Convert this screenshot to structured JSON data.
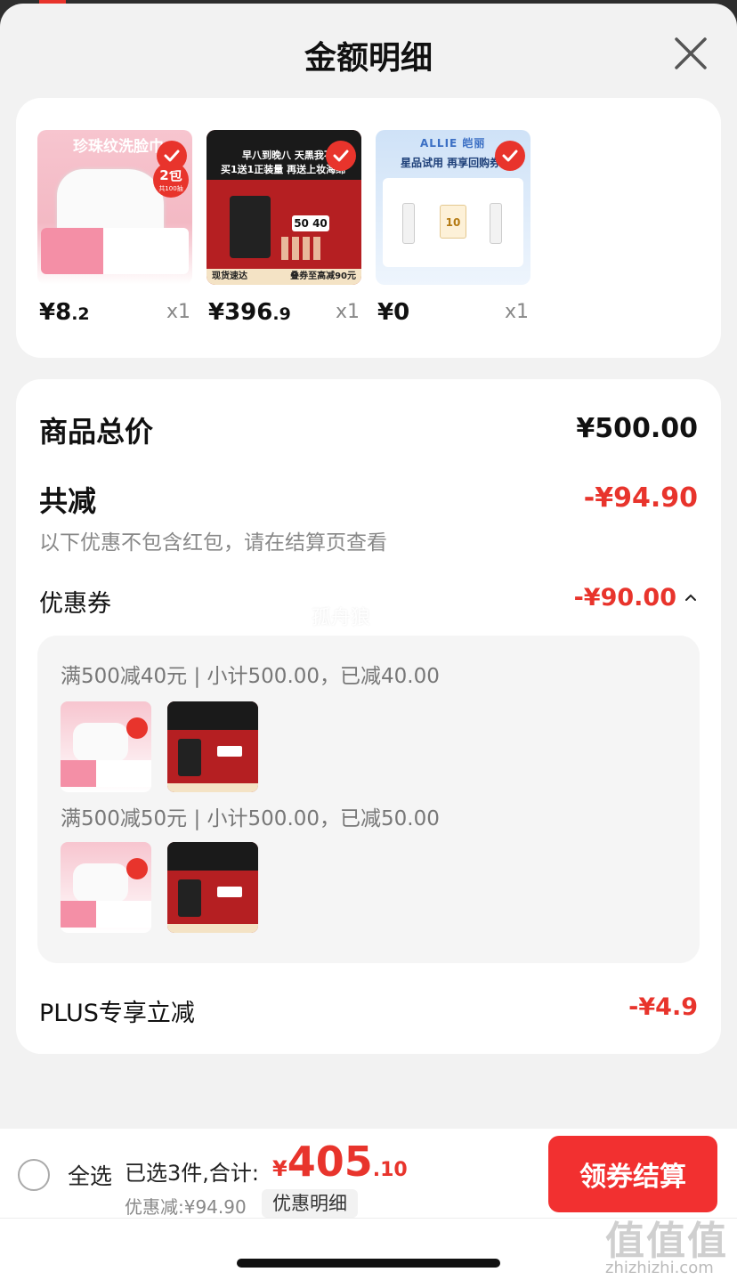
{
  "header": {
    "title": "金额明细"
  },
  "products": [
    {
      "currency": "¥",
      "price_int": "8",
      "price_dec": ".2",
      "qty": "x1",
      "img_text": "珍珠纹洗脸巾",
      "badge": "2包",
      "badge_sub": "共100抽"
    },
    {
      "currency": "¥",
      "price_int": "396",
      "price_dec": ".9",
      "qty": "x1",
      "img_text": "早八到晚八 天黑我不慌",
      "img_text2": "买1送1正装量 再送上妆海绵",
      "img_footer_left": "现货速达",
      "img_footer_right": "叠券至高减90元"
    },
    {
      "currency": "¥",
      "price_int": "0",
      "price_dec": "",
      "qty": "x1",
      "img_brand": "ALLIE 皑丽",
      "img_text": "星品试用 再享回购券"
    }
  ],
  "summary": {
    "goods_total_label": "商品总价",
    "goods_total_value": "¥500.00",
    "discount_label": "共减",
    "discount_value": "-¥94.90",
    "discount_note": "以下优惠不包含红包，请在结算页查看",
    "coupon_label": "优惠券",
    "coupon_value": "-¥90.00",
    "coupon_rules": [
      "满500减40元 | 小计500.00，已减40.00",
      "满500减50元 | 小计500.00，已减50.00"
    ],
    "plus_label": "PLUS专享立减",
    "plus_value": "-¥4.9"
  },
  "watermark": "孤舟狼",
  "bottom": {
    "select_all": "全选",
    "selected": "已选3件,合计:",
    "total_currency": "¥",
    "total_int": "405",
    "total_dec": ".10",
    "discount_line": "优惠减:¥94.90",
    "detail_button": "优惠明细",
    "checkout_button": "领券结算"
  },
  "site_watermark": {
    "logo": "值值值",
    "url": "zhizhizhi.com"
  },
  "colors": {
    "accent": "#e8342c",
    "checkout": "#f23030",
    "bg": "#f2f2f2"
  }
}
